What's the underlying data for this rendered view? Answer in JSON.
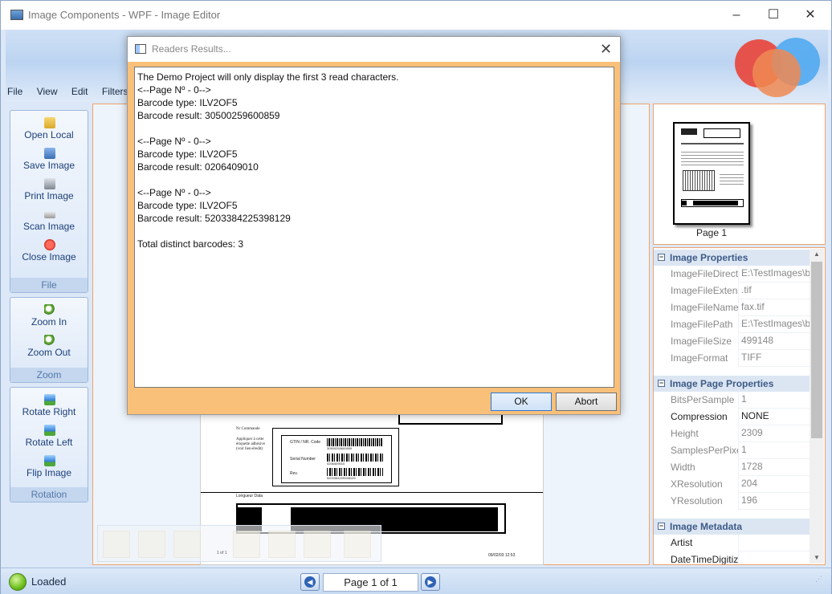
{
  "window": {
    "title": "Image Components - WPF - Image Editor",
    "minimize_glyph": "–",
    "maximize_glyph": "☐",
    "close_glyph": "✕"
  },
  "menu": [
    "File",
    "View",
    "Edit",
    "Filters"
  ],
  "toolbar": {
    "file_group": {
      "caption": "File",
      "buttons": [
        "Open Local",
        "Save Image",
        "Print Image",
        "Scan Image",
        "Close Image"
      ]
    },
    "zoom_group": {
      "caption": "Zoom",
      "buttons": [
        "Zoom In",
        "Zoom Out"
      ]
    },
    "rotation_group": {
      "caption": "Rotation",
      "buttons": [
        "Rotate Right",
        "Rotate Left",
        "Flip Image"
      ]
    }
  },
  "thumbnail": {
    "caption": "Page 1"
  },
  "properties": {
    "image_properties": {
      "title": "Image Properties",
      "rows": [
        {
          "key": "ImageFileDirectory",
          "value": "E:\\TestImages\\ba"
        },
        {
          "key": "ImageFileExtension",
          "value": ".tif"
        },
        {
          "key": "ImageFileName",
          "value": "fax.tif"
        },
        {
          "key": "ImageFilePath",
          "value": "E:\\TestImages\\ba"
        },
        {
          "key": "ImageFileSize",
          "value": "499148"
        },
        {
          "key": "ImageFormat",
          "value": "TIFF"
        }
      ]
    },
    "page_properties": {
      "title": "Image Page Properties",
      "rows": [
        {
          "key": "BitsPerSample",
          "value": "1"
        },
        {
          "key": "Compression",
          "value": "NONE"
        },
        {
          "key": "Height",
          "value": "2309"
        },
        {
          "key": "SamplesPerPixel",
          "value": "1"
        },
        {
          "key": "Width",
          "value": "1728"
        },
        {
          "key": "XResolution",
          "value": "204"
        },
        {
          "key": "YResolution",
          "value": "196"
        }
      ]
    },
    "metadata": {
      "title": "Image Metadata",
      "rows": [
        {
          "key": "Artist",
          "value": ""
        },
        {
          "key": "DateTimeDigitized",
          "value": ""
        }
      ]
    }
  },
  "status": {
    "text": "Loaded",
    "page_indicator": "Page 1 of 1",
    "prev_glyph": "◀",
    "next_glyph": "▶"
  },
  "dialog": {
    "title": "Readers Results...",
    "close_glyph": "✕",
    "body": "The Demo Project will only display the first 3 read characters.\n<--Page Nº - 0-->\nBarcode type: ILV2OF5\nBarcode result: 30500259600859\n\n<--Page Nº - 0-->\nBarcode type: ILV2OF5\nBarcode result: 0206409010\n\n<--Page Nº - 0-->\nBarcode type: ILV2OF5\nBarcode result: 5203384225398129\n\nTotal distinct barcodes: 3",
    "ok_label": "OK",
    "abort_label": "Abort"
  },
  "document_preview": {
    "label_commune": "Nr Commande",
    "label_apply": "Appliquer à cette\nétiquette adhésive\n(voir lien-éredit)",
    "label_gtin": "GTIN / NR. Code",
    "label_serial": "Serial Number",
    "label_rev": "Rev.",
    "barcode_text_1": "30500259600859",
    "barcode_text_2": "0206409010",
    "barcode_text_3": "5203384225398129",
    "label_longueur": "Longueur Data",
    "date_stamp": "09/02/03 12:53",
    "page_stamp": "1 of 1"
  }
}
